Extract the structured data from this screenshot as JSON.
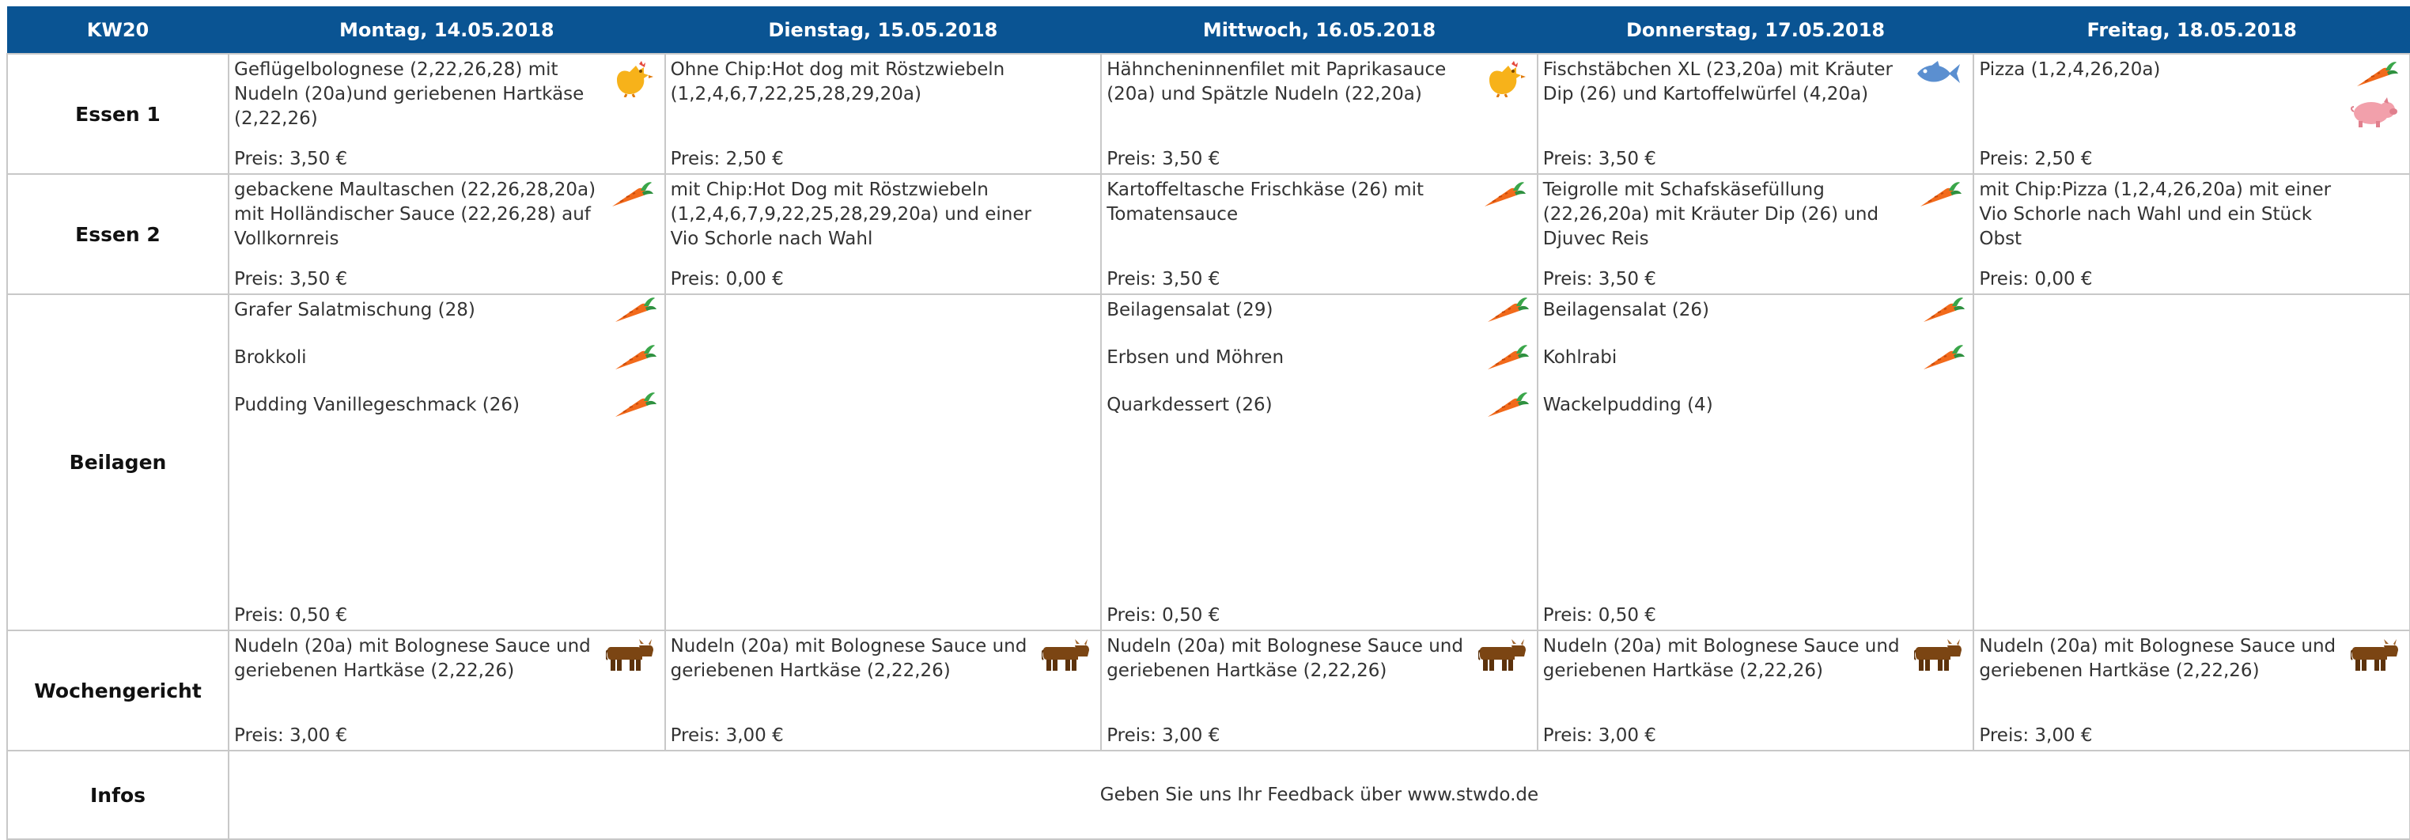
{
  "header": {
    "week": "KW20",
    "days": [
      "Montag, 14.05.2018",
      "Dienstag, 15.05.2018",
      "Mittwoch, 16.05.2018",
      "Donnerstag, 17.05.2018",
      "Freitag, 18.05.2018"
    ]
  },
  "rows": [
    {
      "label": "Essen 1",
      "cells": [
        {
          "text": "Geflügelbolognese (2,22,26,28) mit Nudeln (20a)und geriebenen Hartkäse (2,22,26)",
          "price": "Preis: 3,50 €",
          "icons": [
            "chicken-icon"
          ]
        },
        {
          "text": "Ohne Chip:Hot dog mit Röstzwiebeln (1,2,4,6,7,22,25,28,29,20a)",
          "price": "Preis: 2,50 €",
          "icons": []
        },
        {
          "text": "Hähncheninnenfilet mit Paprikasauce (20a) und Spätzle Nudeln (22,20a)",
          "price": "Preis: 3,50 €",
          "icons": [
            "chicken-icon"
          ]
        },
        {
          "text": "Fischstäbchen XL (23,20a) mit Kräuter Dip (26) und Kartoffelwürfel (4,20a)",
          "price": "Preis: 3,50 €",
          "icons": [
            "fish-icon"
          ]
        },
        {
          "text": "Pizza (1,2,4,26,20a)",
          "price": "Preis: 2,50 €",
          "icons": [
            "carrot-icon",
            "pig-icon"
          ]
        }
      ]
    },
    {
      "label": "Essen 2",
      "cells": [
        {
          "text": "gebackene Maultaschen (22,26,28,20a) mit Holländischer Sauce (22,26,28) auf Vollkornreis",
          "price": "Preis: 3,50 €",
          "icons": [
            "carrot-icon"
          ]
        },
        {
          "text": "mit Chip:Hot Dog mit Röstzwiebeln (1,2,4,6,7,9,22,25,28,29,20a) und einer Vio Schorle nach Wahl",
          "price": "Preis: 0,00 €",
          "icons": []
        },
        {
          "text": "Kartoffeltasche Frischkäse (26) mit Tomatensauce",
          "price": "Preis: 3,50 €",
          "icons": [
            "carrot-icon"
          ]
        },
        {
          "text": "Teigrolle mit Schafskäsefüllung (22,26,20a) mit Kräuter Dip (26) und Djuvec Reis",
          "price": "Preis: 3,50 €",
          "icons": [
            "carrot-icon"
          ]
        },
        {
          "text": "mit Chip:Pizza (1,2,4,26,20a) mit einer Vio Schorle nach Wahl und ein Stück Obst",
          "price": "Preis: 0,00 €",
          "icons": []
        }
      ]
    },
    {
      "label": "Beilagen",
      "cells": [
        {
          "items": [
            {
              "text": "Grafer Salatmischung  (28)",
              "icons": [
                "carrot-icon"
              ]
            },
            {
              "text": "Brokkoli",
              "icons": [
                "carrot-icon"
              ]
            },
            {
              "text": "Pudding Vanillegeschmack (26)",
              "icons": [
                "carrot-icon"
              ]
            }
          ],
          "price": "Preis: 0,50 €"
        },
        {
          "items": [],
          "price": ""
        },
        {
          "items": [
            {
              "text": "Beilagensalat (29)",
              "icons": [
                "carrot-icon"
              ]
            },
            {
              "text": "Erbsen und Möhren",
              "icons": [
                "carrot-icon"
              ]
            },
            {
              "text": "Quarkdessert (26)",
              "icons": [
                "carrot-icon"
              ]
            }
          ],
          "price": "Preis: 0,50 €"
        },
        {
          "items": [
            {
              "text": "Beilagensalat (26)",
              "icons": [
                "carrot-icon"
              ]
            },
            {
              "text": "Kohlrabi",
              "icons": [
                "carrot-icon"
              ]
            },
            {
              "text": "Wackelpudding (4)",
              "icons": []
            }
          ],
          "price": "Preis: 0,50 €"
        },
        {
          "items": [],
          "price": ""
        }
      ]
    },
    {
      "label": "Wochengericht",
      "cells": [
        {
          "text": "Nudeln (20a) mit Bolognese Sauce und geriebenen Hartkäse (2,22,26)",
          "price": "Preis: 3,00 €",
          "icons": [
            "cow-icon"
          ]
        },
        {
          "text": "Nudeln (20a) mit Bolognese Sauce und geriebenen Hartkäse (2,22,26)",
          "price": "Preis: 3,00 €",
          "icons": [
            "cow-icon"
          ]
        },
        {
          "text": "Nudeln (20a) mit Bolognese Sauce und geriebenen Hartkäse (2,22,26)",
          "price": "Preis: 3,00 €",
          "icons": [
            "cow-icon"
          ]
        },
        {
          "text": "Nudeln (20a) mit Bolognese Sauce und geriebenen Hartkäse (2,22,26)",
          "price": "Preis: 3,00 €",
          "icons": [
            "cow-icon"
          ]
        },
        {
          "text": "Nudeln (20a) mit Bolognese Sauce und geriebenen Hartkäse (2,22,26)",
          "price": "Preis: 3,00 €",
          "icons": [
            "cow-icon"
          ]
        }
      ]
    }
  ],
  "infos": {
    "label": "Infos",
    "text": "Geben Sie uns Ihr Feedback über www.stwdo.de"
  },
  "colors": {
    "header_bg": "#0a5493",
    "header_text": "#ffffff",
    "grid": "#c8c8c8"
  }
}
